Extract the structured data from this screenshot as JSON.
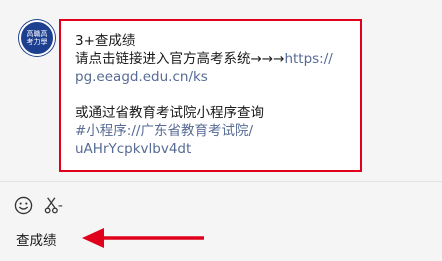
{
  "avatar": {
    "text": "高職高考力學"
  },
  "message": {
    "line1": "3+查成绩",
    "line2_text": "请点击链接进入官方高考系统→→→",
    "line2_link": "https://",
    "line3_link": "pg.eeagd.edu.cn/ks",
    "line5": "或通过省教育考试院小程序查询",
    "line6_link": "#小程序://广东省教育考试院/",
    "line7_link": "uAHrYcpkvlbv4dt"
  },
  "input": {
    "typed_text": "查成绩"
  },
  "colors": {
    "highlight_border": "#e0001b",
    "link": "#576b95",
    "arrow": "#e0001b"
  },
  "icons": {
    "emoji": "emoji-icon",
    "scissors": "scissors-icon"
  }
}
